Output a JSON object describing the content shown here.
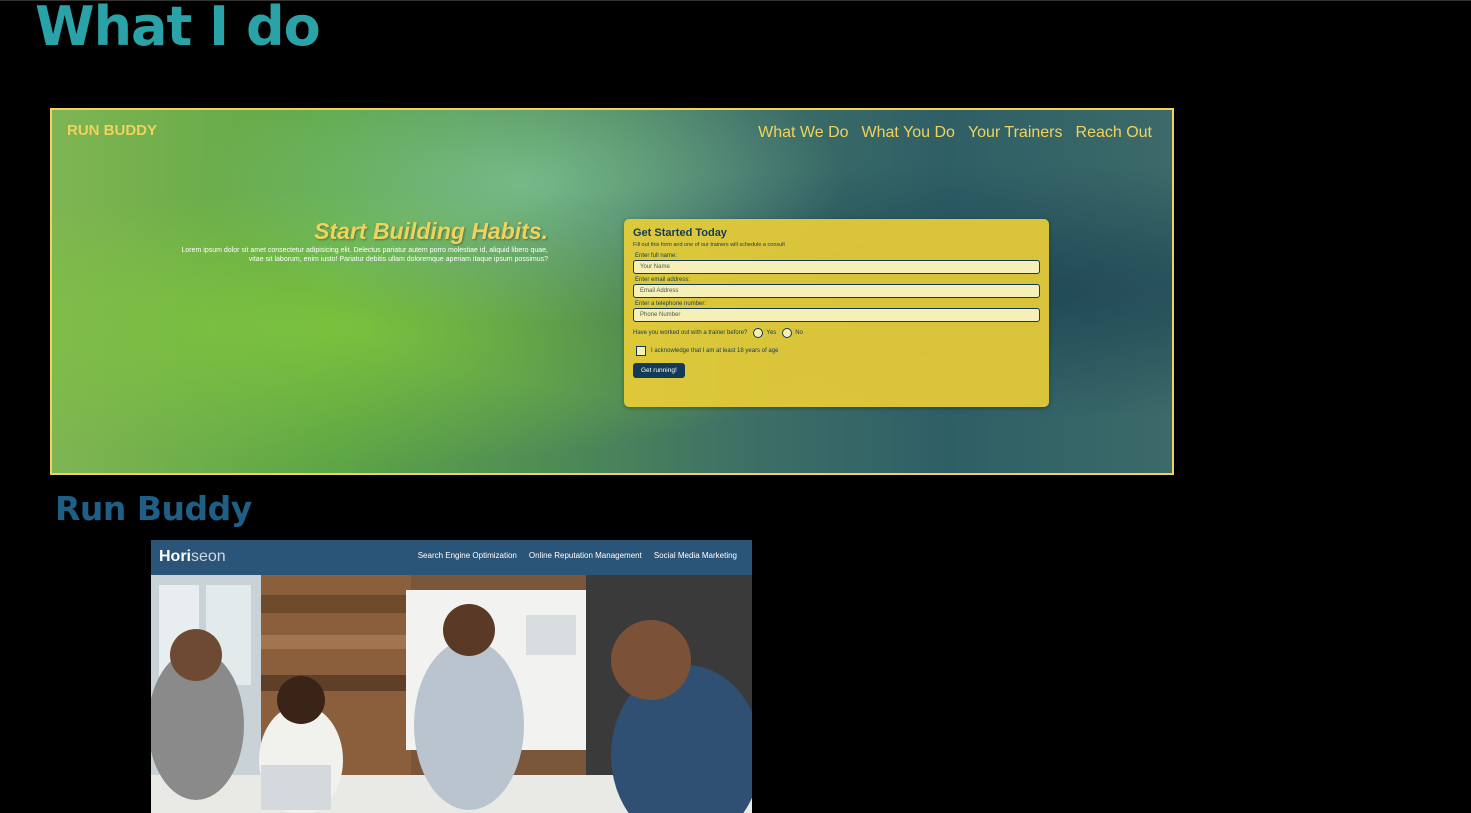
{
  "section": {
    "title": "What I do"
  },
  "runbuddy": {
    "logo": "RUN BUDDY",
    "nav": [
      "What We Do",
      "What You Do",
      "Your Trainers",
      "Reach Out"
    ],
    "hero_title": "Start Building Habits.",
    "hero_text": "Lorem ipsum dolor sit amet consectetur adipisicing elit. Delectus pariatur autem porro molestiae id, aliquid libero quae, vitae sit laborum, enim iusto! Pariatur debitis ullam doloremque aperiam itaque ipsum possimus?",
    "form": {
      "title": "Get Started Today",
      "subtitle": "Fill out this form and one of our trainers will schedule a consult",
      "name_label": "Enter full name:",
      "name_placeholder": "Your Name",
      "email_label": "Enter email address:",
      "email_placeholder": "Email Address",
      "phone_label": "Enter a telephone number:",
      "phone_placeholder": "Phone Number",
      "question": "Have you worked out with a trainer before?",
      "yes": "Yes",
      "no": "No",
      "acknowledge": "I acknowledge that I am at least 18 years of age",
      "submit": "Get running!"
    }
  },
  "project": {
    "title": "Run Buddy"
  },
  "horiseon": {
    "logo_main": "Hori",
    "logo_accent": "seon",
    "nav": [
      "Search Engine Optimization",
      "Online Reputation Management",
      "Social Media Marketing"
    ]
  },
  "colors": {
    "section_title": "#2aa3a8",
    "project_title": "#1f5f85",
    "runbuddy_yellow": "#f0d35c",
    "runbuddy_navy": "#143b55",
    "horiseon_header": "#2a5478"
  }
}
